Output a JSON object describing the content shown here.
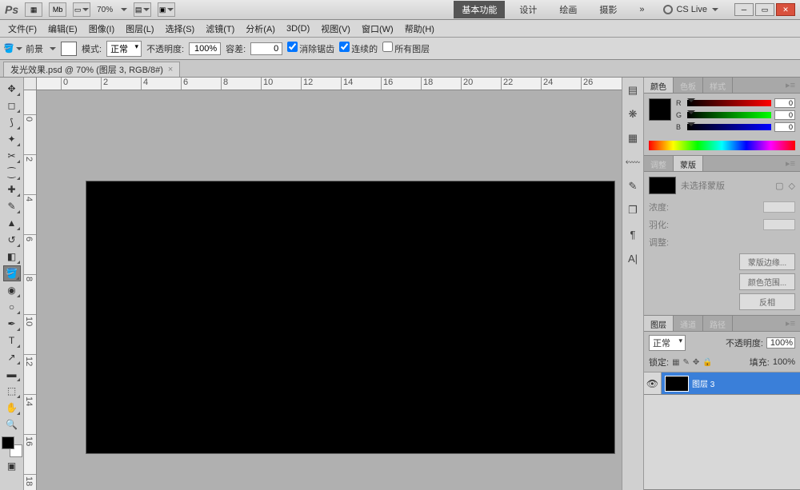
{
  "topbar": {
    "logo": "Ps",
    "zoom": "70%",
    "workspace_tabs": [
      "基本功能",
      "设计",
      "绘画",
      "摄影"
    ],
    "active_workspace": 0,
    "more": "»",
    "cslive": "CS Live"
  },
  "menu": [
    "文件(F)",
    "编辑(E)",
    "图像(I)",
    "图层(L)",
    "选择(S)",
    "滤镜(T)",
    "分析(A)",
    "3D(D)",
    "视图(V)",
    "窗口(W)",
    "帮助(H)"
  ],
  "options": {
    "fg_label": "前景",
    "mode_label": "模式:",
    "mode_value": "正常",
    "opacity_label": "不透明度:",
    "opacity_value": "100%",
    "tolerance_label": "容差:",
    "tolerance_value": "0",
    "antialias": "消除锯齿",
    "contiguous": "连续的",
    "all_layers": "所有图层"
  },
  "document": {
    "tab_title": "发光效果.psd @ 70% (图层 3, RGB/8#)"
  },
  "panels": {
    "color_tabs": [
      "颜色",
      "色板",
      "样式"
    ],
    "color_r": "0",
    "color_g": "0",
    "color_b": "0",
    "mask_tabs": [
      "调整",
      "蒙版"
    ],
    "mask_none": "未选择蒙版",
    "mask_density": "浓度:",
    "mask_feather": "羽化:",
    "mask_adjust": "调整:",
    "mask_edge": "蒙版边缘...",
    "mask_colorrange": "颜色范围...",
    "mask_invert": "反相",
    "layer_tabs": [
      "图层",
      "通道",
      "路径"
    ],
    "blend_mode": "正常",
    "opacity_label": "不透明度:",
    "opacity_value": "100%",
    "lock_label": "锁定:",
    "fill_label": "填充:",
    "fill_value": "100%",
    "layer_name": "图层 3"
  }
}
